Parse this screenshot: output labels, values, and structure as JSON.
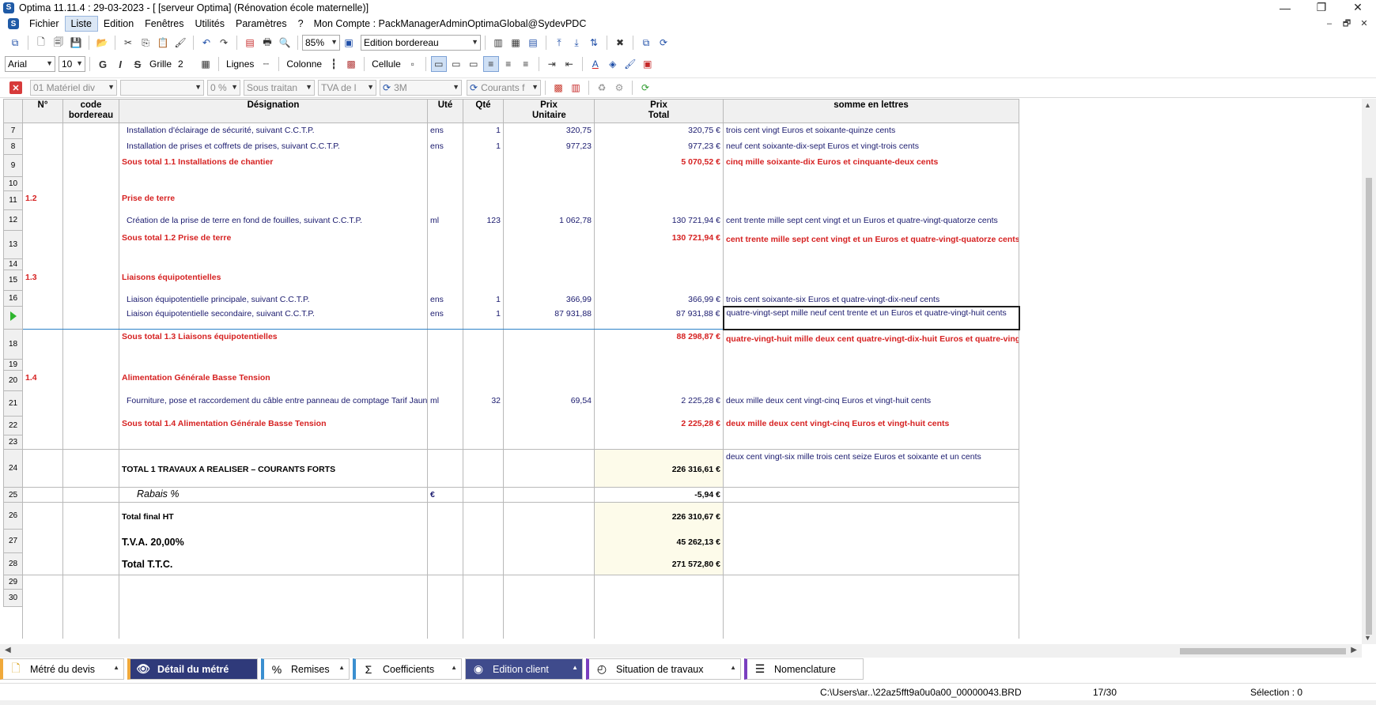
{
  "window": {
    "title": "Optima 11.11.4 : 29-03-2023 - [ [serveur Optima] (Rénovation école maternelle)]",
    "app_icon": "S",
    "controls": [
      "—",
      "❐",
      "✕"
    ]
  },
  "menu": {
    "items": [
      "Fichier",
      "Liste",
      "Edition",
      "Fenêtres",
      "Utilités",
      "Paramètres",
      "?"
    ],
    "active": "Liste",
    "account": "Mon Compte : PackManagerAdminOptimaGlobal@SydevPDC",
    "mdi_controls": [
      "–",
      "🗗",
      "✕"
    ]
  },
  "toolbar1": {
    "zoom": "85%",
    "view_select": "Edition bordereau"
  },
  "toolbar2": {
    "font": "Arial",
    "font_size": "10",
    "bold": "G",
    "italic": "I",
    "strike": "S",
    "grid_label": "Grille",
    "grid_value": "2",
    "lines_label": "Lignes",
    "columns_label": "Colonne",
    "cell_label": "Cellule",
    "text_color_icon": "A"
  },
  "toolbar3": {
    "materiel": "01  Matériel div",
    "empty_select": "",
    "percent": "0 %",
    "sous_traitant": "Sous traitan",
    "tva": "TVA de l",
    "ref3m": "3M",
    "courants": "Courants f"
  },
  "grid": {
    "headers": {
      "num": "N°",
      "code": "code bordereau",
      "designation": "Désignation",
      "ute": "Uté",
      "qte": "Qté",
      "pu": "Prix Unitaire",
      "pt": "Prix Total",
      "lettres": "somme en lettres"
    },
    "rows": {
      "r7": {
        "rn": "7",
        "des": "Installation d'éclairage de sécurité, suivant C.C.T.P.",
        "ute": "ens",
        "qte": "1",
        "pu": "320,75",
        "pt": "320,75 €",
        "lettres": "trois cent vingt Euros et  soixante-quinze cents"
      },
      "r8": {
        "rn": "8",
        "des": "Installation de prises et coffrets de prises, suivant C.C.T.P.",
        "ute": "ens",
        "qte": "1",
        "pu": "977,23",
        "pt": "977,23 €",
        "lettres": "neuf cent  soixante-dix-sept Euros et vingt-trois cents"
      },
      "r9": {
        "rn": "9",
        "des": "Sous total 1.1 Installations de chantier",
        "pt": "5 070,52 €",
        "lettres": "cinq mille  soixante-dix Euros et cinquante-deux cents"
      },
      "r10": {
        "rn": "10"
      },
      "r11": {
        "rn": "11",
        "num": "1.2",
        "des": "Prise de terre"
      },
      "r12": {
        "rn": "12",
        "des": "Création de la prise de terre en fond de fouilles, suivant C.C.T.P.",
        "ute": "ml",
        "qte": "123",
        "pu": "1 062,78",
        "pt": "130 721,94 €",
        "lettres": "cent trente mille sept cent vingt et un Euros et  quatre-vingt-quatorze cents"
      },
      "r13": {
        "rn": "13",
        "des": "Sous total 1.2 Prise de terre",
        "pt": "130 721,94 €",
        "lettres": "cent trente mille sept cent vingt et un Euros et quatre-vingt-quatorze cents"
      },
      "r14": {
        "rn": "14"
      },
      "r15": {
        "rn": "15",
        "num": "1.3",
        "des": "Liaisons équipotentielles"
      },
      "r16": {
        "rn": "16",
        "des": "Liaison équipotentielle principale, suivant C.C.T.P.",
        "ute": "ens",
        "qte": "1",
        "pu": "366,99",
        "pt": "366,99 €",
        "lettres": "trois cent soixante-six Euros et  quatre-vingt-dix-neuf cents"
      },
      "r17": {
        "rn": "",
        "des": "Liaison équipotentielle secondaire, suivant C.C.T.P.",
        "ute": "ens",
        "qte": "1",
        "pu": "87 931,88",
        "pt": "87 931,88 €",
        "lettres": "quatre-vingt-sept mille neuf cent trente et un Euros et quatre-vingt-huit cents"
      },
      "r18": {
        "rn": "18",
        "des": "Sous total 1.3 Liaisons équipotentielles",
        "pt": "88 298,87 €",
        "lettres": "quatre-vingt-huit mille deux cent  quatre-vingt-dix-huit Euros et quatre-vingt-sept cents"
      },
      "r19": {
        "rn": "19"
      },
      "r20": {
        "rn": "20",
        "num": "1.4",
        "des": "Alimentation Générale Basse Tension"
      },
      "r21": {
        "rn": "21",
        "des": "Fourniture, pose et raccordement du câble entre panneau de comptage Tarif Jaune et T.G.B.T.",
        "ute": "ml",
        "qte": "32",
        "pu": "69,54",
        "pt": "2 225,28 €",
        "lettres": "deux mille deux cent vingt-cinq Euros et vingt-huit cents"
      },
      "r22": {
        "rn": "22",
        "des": "Sous total 1.4 Alimentation Générale Basse Tension",
        "pt": "2 225,28 €",
        "lettres": "deux mille deux cent vingt-cinq Euros et vingt-huit cents"
      },
      "r23": {
        "rn": "23"
      },
      "r24": {
        "rn": "24",
        "des": "TOTAL 1  TRAVAUX A REALISER – COURANTS FORTS",
        "pt": "226 316,61 €",
        "lettres": "deux cent vingt-six mille trois cent seize Euros et soixante et un cents"
      },
      "r25": {
        "rn": "25",
        "des": "Rabais %",
        "ute": "€",
        "pt": "-5,94 €"
      },
      "r26": {
        "rn": "26",
        "des": "Total final HT",
        "pt": "226 310,67 €"
      },
      "r27": {
        "rn": "27",
        "des": "T.V.A. 20,00%",
        "pt": "45 262,13 €"
      },
      "r28": {
        "rn": "28",
        "des": "Total  T.T.C.",
        "pt": "271 572,80 €"
      },
      "r29": {
        "rn": "29"
      },
      "r30": {
        "rn": "30"
      }
    }
  },
  "tabs": [
    {
      "label": "Métré du devis",
      "icon": "document-icon"
    },
    {
      "label": "Détail du métré",
      "icon": "eye-icon"
    },
    {
      "label": "Remises",
      "icon": "percent-icon"
    },
    {
      "label": "Coefficients",
      "icon": "sigma-icon"
    },
    {
      "label": "Edition client",
      "icon": "user-icon"
    },
    {
      "label": "Situation de travaux",
      "icon": "clock-icon"
    },
    {
      "label": "Nomenclature",
      "icon": "list-icon"
    }
  ],
  "status": {
    "path": "C:\\Users\\ar..\\22az5fft9a0u0a00_00000043.BRD",
    "position": "17/30",
    "selection": "Sélection : 0"
  },
  "colors": {
    "subtotal_red": "#d62222",
    "active_tab": "#2f3a7a",
    "yellow_cell": "#fdfbea"
  }
}
